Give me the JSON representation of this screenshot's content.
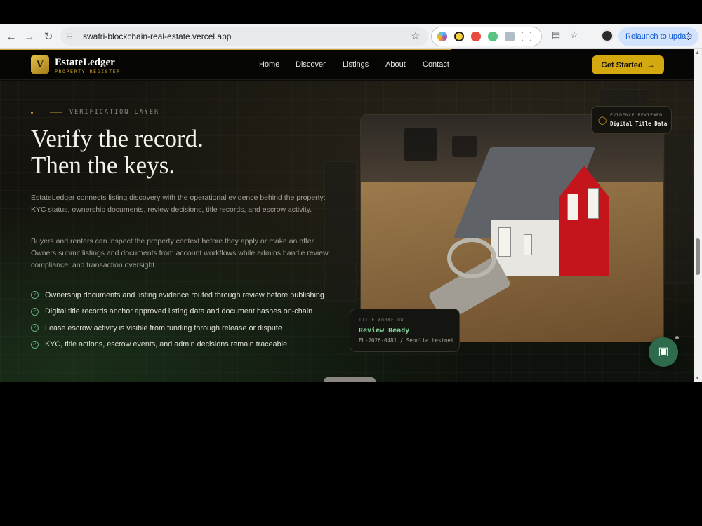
{
  "browser": {
    "url": "swafri-blockchain-real-estate.vercel.app",
    "relaunch_label": "Relaunch to update"
  },
  "site": {
    "logo_letter": "V",
    "logo_name": "EstateLedger",
    "logo_tagline": "PROPERTY REGISTER",
    "nav": [
      "Home",
      "Discover",
      "Listings",
      "About",
      "Contact"
    ],
    "cta_label": "Get Started",
    "accent_color": "#d4a80f"
  },
  "hero": {
    "eyebrow": "VERIFICATION LAYER",
    "headline_line1": "Verify the record.",
    "headline_line2": "Then the keys.",
    "paragraph1": "EstateLedger connects listing discovery with the operational evidence behind the property: KYC status, ownership documents, review decisions, title records, and escrow activity.",
    "paragraph2": "Buyers and renters can inspect the property context before they apply or make an offer. Owners submit listings and documents from account workflows while admins handle review, compliance, and transaction oversight.",
    "checks": [
      "Ownership documents and listing evidence routed through review before publishing",
      "Digital title records anchor approved listing data and document hashes on-chain",
      "Lease escrow activity is visible from funding through release or dispute",
      "KYC, title actions, escrow events, and admin decisions remain traceable"
    ]
  },
  "evidence_card": {
    "label": "EVIDENCE REVIEWED",
    "value": "Digital Title Data"
  },
  "workflow_card": {
    "label": "TITLE WORKFLOW",
    "status": "Review Ready",
    "reference": "EL-2026-0481 / Sepolia testnet"
  }
}
